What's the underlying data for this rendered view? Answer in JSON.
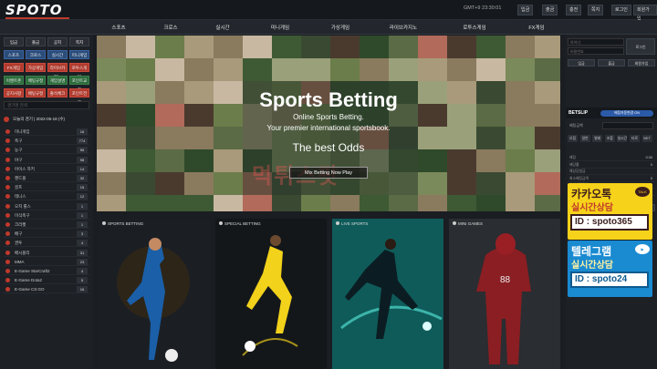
{
  "logo": "SPOTO",
  "topbar": {
    "clock": "GMT+9 23:30:01",
    "buttons": [
      "입금",
      "출금",
      "충전",
      "쪽지",
      "로그인",
      "회원가입"
    ]
  },
  "nav": [
    "스포츠",
    "크로스",
    "실시간",
    "미니게임",
    "가상게임",
    "라이브카지노",
    "로투스게임",
    "FX게임"
  ],
  "quick": [
    "입금",
    "출금",
    "공지",
    "쪽지",
    "스포츠",
    "크로스",
    "실시간",
    "미니게임",
    "FX게임",
    "가상게임",
    "라이브카지노",
    "로투스게임",
    "이벤트존",
    "배팅규정",
    "게임설명",
    "포인트교환",
    "공지사항",
    "배팅규정",
    "출석체크",
    "포인트전환"
  ],
  "left": {
    "search_placeholder": "경기명 검색",
    "today": "오늘의 경기 | 2022-05-18 (수)",
    "sports": [
      {
        "name": "미니게임",
        "count": "16"
      },
      {
        "name": "축구",
        "count": "774"
      },
      {
        "name": "농구",
        "count": "55"
      },
      {
        "name": "야구",
        "count": "98"
      },
      {
        "name": "아이스 하키",
        "count": "14"
      },
      {
        "name": "핸드볼",
        "count": "32"
      },
      {
        "name": "골프",
        "count": "15"
      },
      {
        "name": "테니스",
        "count": "12"
      },
      {
        "name": "오지 룰스",
        "count": "1"
      },
      {
        "name": "미식축구",
        "count": "1"
      },
      {
        "name": "크리켓",
        "count": "1"
      },
      {
        "name": "배구",
        "count": "3"
      },
      {
        "name": "권투",
        "count": "4"
      },
      {
        "name": "배시볼리",
        "count": "31"
      },
      {
        "name": "MMA",
        "count": "23"
      },
      {
        "name": "E-Game StarCraft2",
        "count": "4"
      },
      {
        "name": "E-Game Dota2",
        "count": "5"
      },
      {
        "name": "E-Game CS:GO",
        "count": "16"
      }
    ]
  },
  "hero": {
    "title": "Sports Betting",
    "sub1": "Online Sports Betting.",
    "sub2": "Your premier international sportsbook.",
    "odds": "The best Odds",
    "button": "Mix Betting Now Play",
    "watermark": "먹튀스팟"
  },
  "cards": [
    "SPORTS BETTING",
    "SPECIAL BETTING",
    "LIVE SPORTS",
    "MINI GAMES"
  ],
  "right": {
    "id_placeholder": "아이디",
    "pw_placeholder": "비밀번호",
    "login": "로그인",
    "btns": [
      "입금",
      "출금",
      "회원가입"
    ],
    "betslip": "BETSLIP",
    "toggle": "배팅자동변경 ON",
    "bet_amount": "배팅금액",
    "tabs": [
      "오점",
      "일반",
      "발레",
      "조합",
      "실시간",
      "타로",
      "BET"
    ],
    "rows": [
      {
        "label": "배팅",
        "value": "0.00"
      },
      {
        "label": "배당률",
        "value": "0"
      },
      {
        "label": "예상당첨금",
        "value": ""
      },
      {
        "label": "최소배팅금액",
        "value": "0"
      },
      {
        "label": "최대배팅금액",
        "value": "0"
      },
      {
        "label": "최대당첨금액",
        "value": "0"
      },
      {
        "label": "보유금액",
        "value": "0"
      }
    ],
    "login_notice": "로그인후이용하세요",
    "clear": "전체취소"
  },
  "banners": [
    {
      "t1": "카카오톡",
      "t2": "실시간상담",
      "id": "ID : spoto365",
      "icon": "TALK"
    },
    {
      "t1": "텔레그램",
      "t2": "실시간상담",
      "id": "ID : spoto24",
      "icon": "▶"
    }
  ]
}
